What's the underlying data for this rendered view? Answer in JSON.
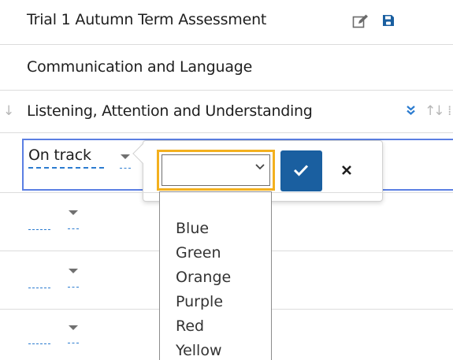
{
  "header": {
    "title": "Trial 1 Autumn Term Assessment",
    "edit_icon": "edit-icon",
    "save_icon": "save-icon"
  },
  "section": {
    "name": "Communication and Language"
  },
  "subsection": {
    "name": "Listening, Attention and Understanding",
    "expand_icon": "double-chevron-down-icon",
    "sort_icon": "sort-arrows-icon"
  },
  "active_cell": {
    "value": "On track",
    "editor": {
      "select_value": "",
      "options": [
        "Blue",
        "Green",
        "Orange",
        "Purple",
        "Red",
        "Yellow"
      ],
      "confirm_icon": "check-icon",
      "cancel_icon": "close-icon"
    }
  },
  "colors": {
    "accent_blue": "#1a5fa0",
    "focus_yellow": "#f3b01e",
    "row_border": "#5b7fe3",
    "link_blue": "#2c7cd0"
  }
}
